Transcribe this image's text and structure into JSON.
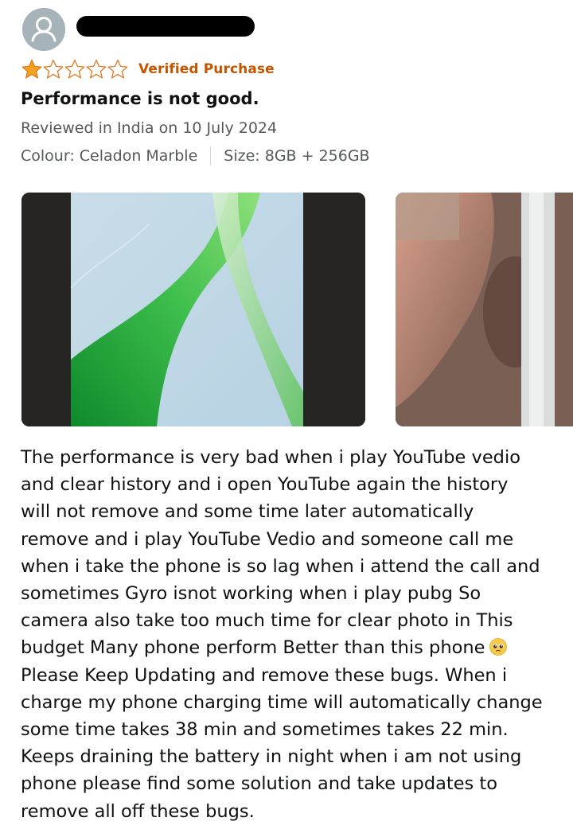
{
  "reviewer": {
    "avatar_icon": "default-user-avatar-icon"
  },
  "rating": {
    "value": 1,
    "max": 5,
    "star_color": "#f4a41c",
    "verified_label": "Verified Purchase",
    "verified_color": "#c45500"
  },
  "review": {
    "title": "Performance is not good.",
    "date_line": "Reviewed in India on 10 July 2024",
    "colour": "Colour: Celadon Marble",
    "size": "Size: 8GB + 256GB",
    "body_lines": [
      "The performance is very bad when i play YouTube vedio",
      "and clear history and i open YouTube again the history",
      "will not remove and some time later automatically",
      "remove and i play YouTube Vedio and someone call me",
      "when i take the phone is so lag when i attend the call and",
      "sometimes Gyro isnot working when i play pubg So",
      "camera also take too much time for clear photo in This",
      "budget Many phone perform Better than this phone",
      "Please Keep Updating and remove these bugs. When i",
      "charge my phone charging time will automatically change",
      "some time takes 38 min and sometimes takes 22 min.",
      "Keeps draining the battery in night when i am not using",
      "phone please find some solution and take updates to",
      "remove all off these bugs."
    ],
    "emoji_icon": "pleading-face-emoji-icon"
  },
  "photos": [
    {
      "icon": "phone-screen-wallpaper-photo"
    },
    {
      "icon": "hand-holding-phone-photo"
    }
  ]
}
